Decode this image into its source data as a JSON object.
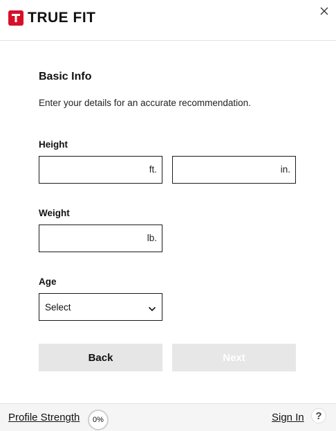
{
  "header": {
    "logo_text": "TRUE FIT",
    "logo_mark_letter": "T",
    "brand_color": "#d7102a",
    "close_icon": "close-icon"
  },
  "form": {
    "title": "Basic Info",
    "subtitle": "Enter your details for an accurate recommendation.",
    "height": {
      "label": "Height",
      "feet": {
        "value": "",
        "unit": "ft."
      },
      "inches": {
        "value": "",
        "unit": "in."
      }
    },
    "weight": {
      "label": "Weight",
      "value": "",
      "unit": "lb."
    },
    "age": {
      "label": "Age",
      "selected": "Select"
    },
    "buttons": {
      "back": "Back",
      "next": "Next"
    }
  },
  "footer": {
    "profile_strength_label": "Profile Strength",
    "profile_strength_value": "0%",
    "sign_in": "Sign In",
    "help": "?"
  }
}
